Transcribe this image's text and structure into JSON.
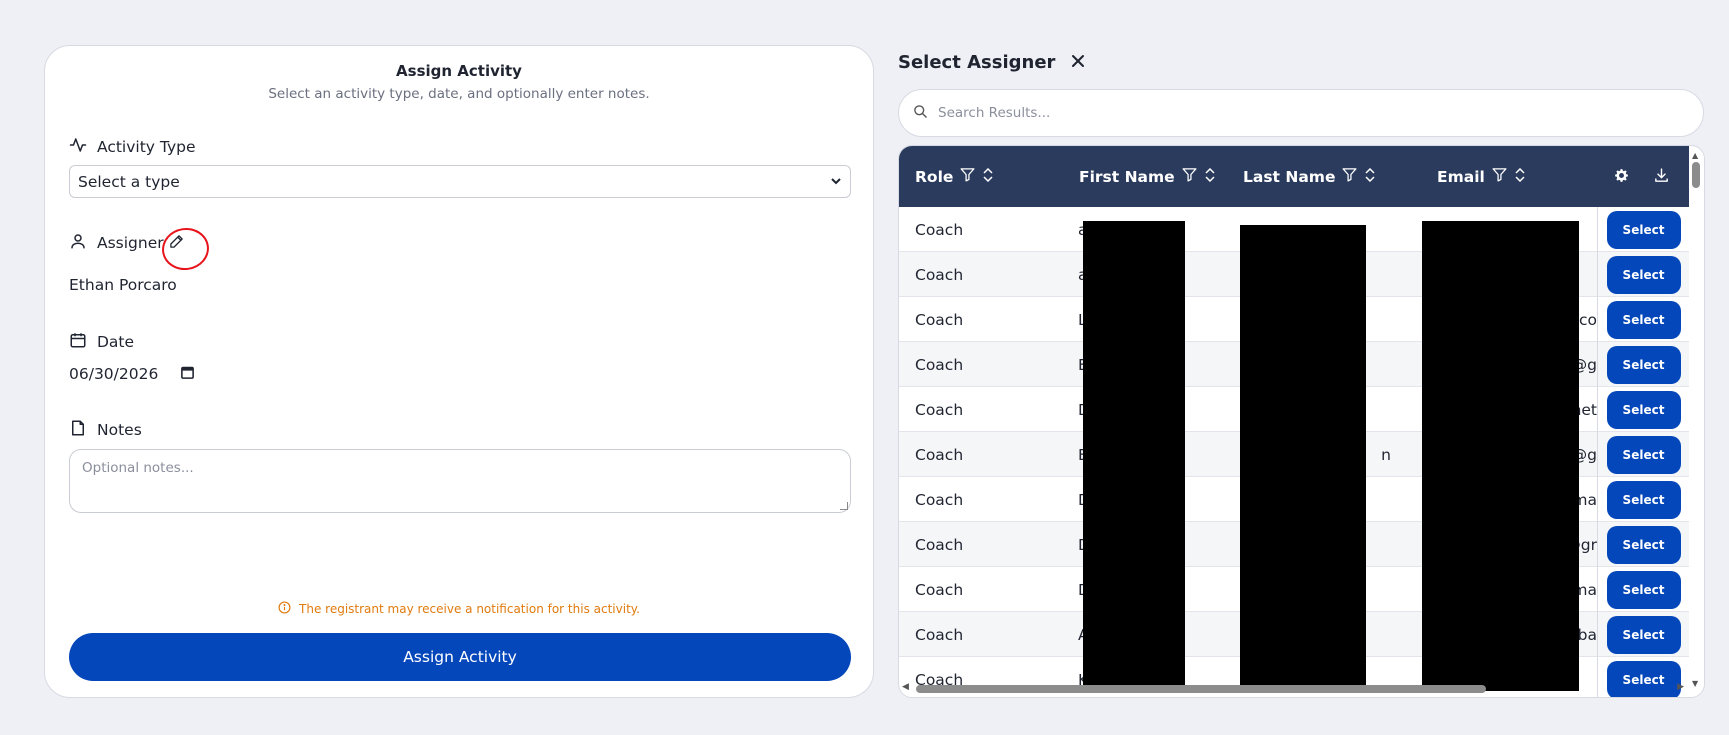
{
  "form": {
    "title": "Assign Activity",
    "subtitle": "Select an activity type, date, and optionally enter notes.",
    "activity_type_label": "Activity Type",
    "activity_type_value": "Select a type",
    "assigner_label": "Assigner",
    "assigner_value": "Ethan Porcaro",
    "date_label": "Date",
    "date_value": "06/30/2026",
    "notes_label": "Notes",
    "notes_placeholder": "Optional notes...",
    "notice": "The registrant may receive a notification for this activity.",
    "submit_label": "Assign Activity"
  },
  "panel": {
    "title": "Select Assigner",
    "search_placeholder": "Search Results...",
    "columns": [
      "Role",
      "First Name",
      "Last Name",
      "Email"
    ],
    "select_label": "Select",
    "rows": [
      {
        "role": "Coach",
        "first": "a",
        "last": "",
        "email": ""
      },
      {
        "role": "Coach",
        "first": "a",
        "last": "",
        "email": ""
      },
      {
        "role": "Coach",
        "first": "L",
        "last": "",
        "email": "l.co"
      },
      {
        "role": "Coach",
        "first": "B",
        "last": "",
        "email": "@g"
      },
      {
        "role": "Coach",
        "first": "D",
        "last": "",
        "email": "net"
      },
      {
        "role": "Coach",
        "first": "B",
        "last": "n",
        "email": "@g"
      },
      {
        "role": "Coach",
        "first": "D",
        "last": "",
        "email": "ma"
      },
      {
        "role": "Coach",
        "first": "D",
        "last": "",
        "email": "@gr"
      },
      {
        "role": "Coach",
        "first": "D",
        "last": "",
        "email": "ma"
      },
      {
        "role": "Coach",
        "first": "A",
        "last": "",
        "email": "aba"
      },
      {
        "role": "Coach",
        "first": "K",
        "last": "",
        "email": ""
      }
    ]
  },
  "colors": {
    "primary": "#0447bb",
    "header_bg": "#2b3b5e",
    "notice": "#e07b10",
    "highlight_circle": "#e8141c"
  },
  "icons": [
    "activity-icon",
    "user-icon",
    "pencil-icon",
    "calendar-icon",
    "file-icon",
    "info-icon",
    "close-icon",
    "search-icon",
    "filter-icon",
    "sort-icon",
    "gear-icon",
    "download-icon"
  ]
}
